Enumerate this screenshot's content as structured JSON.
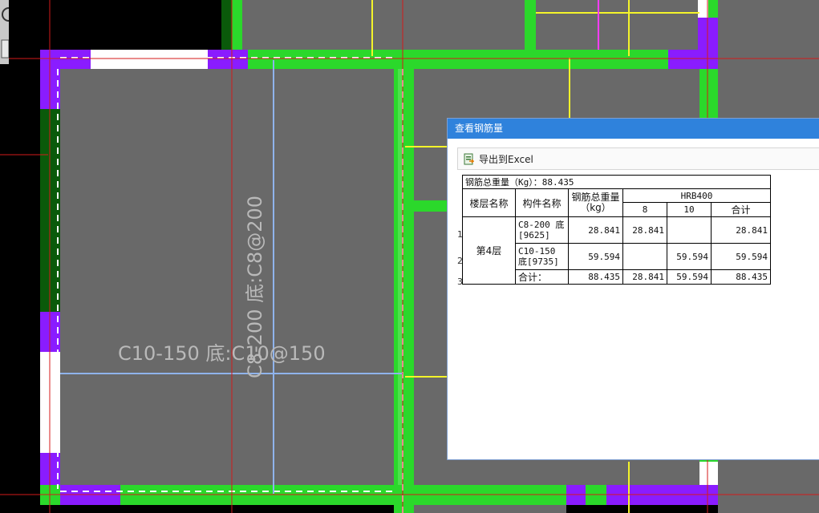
{
  "drawing": {
    "label_horizontal": "C10-150 底:C10@150",
    "label_vertical": "C8-200 底:C8@200",
    "colors": {
      "background": "#000000",
      "slab": "#696969",
      "wall_green": "#2bd82b",
      "wall_dark_green": "#0a5a0a",
      "column_purple": "#8a1cff",
      "axis_red": "#d41a1a",
      "rebar_blue": "#8fb3ec",
      "line_yellow": "#f4f42a",
      "line_magenta": "#ff3cff"
    }
  },
  "dialog": {
    "title": "查看钢筋量",
    "toolbar": {
      "export_label": "导出到Excel",
      "export_icon": "excel-export-icon"
    },
    "summary": "钢筋总重量（Kg）：88.435",
    "headers": {
      "floor": "楼层名称",
      "member": "构件名称",
      "total_weight": "钢筋总重量（kg）",
      "grade": "HRB400",
      "d8": "8",
      "d10": "10",
      "subtotal": "合计"
    },
    "floor_name": "第4层",
    "rows": [
      {
        "num": "1",
        "member": "C8-200 底[9625]",
        "total": "28.841",
        "d8": "28.841",
        "d10": "",
        "subtotal": "28.841"
      },
      {
        "num": "2",
        "member": "C10-150 底[9735]",
        "total": "59.594",
        "d8": "",
        "d10": "59.594",
        "subtotal": "59.594"
      },
      {
        "num": "3",
        "member": "合计：",
        "total": "88.435",
        "d8": "28.841",
        "d10": "59.594",
        "subtotal": "88.435"
      }
    ]
  }
}
